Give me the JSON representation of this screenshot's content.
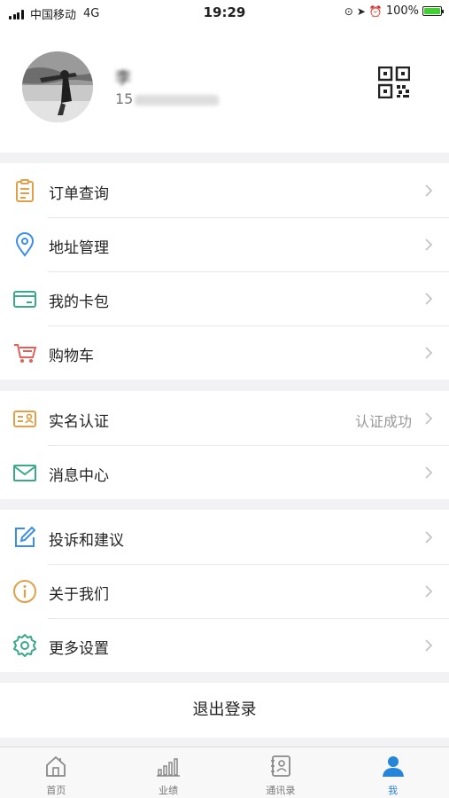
{
  "status_bar": {
    "carrier": "中国移动",
    "network": "4G",
    "time": "19:29",
    "battery_text": "100%",
    "battery_level": 1.0
  },
  "profile": {
    "name": "李",
    "phone_prefix": "15"
  },
  "menu_group_1": [
    {
      "label": "订单查询",
      "icon": "clipboard-icon"
    },
    {
      "label": "地址管理",
      "icon": "location-pin-icon"
    },
    {
      "label": "我的卡包",
      "icon": "card-icon"
    },
    {
      "label": "购物车",
      "icon": "cart-icon"
    }
  ],
  "menu_group_2": [
    {
      "label": "实名认证",
      "value": "认证成功",
      "icon": "id-card-icon"
    },
    {
      "label": "消息中心",
      "icon": "envelope-icon"
    }
  ],
  "menu_group_3": [
    {
      "label": "投诉和建议",
      "icon": "edit-icon"
    },
    {
      "label": "关于我们",
      "icon": "info-icon"
    },
    {
      "label": "更多设置",
      "icon": "gear-icon"
    }
  ],
  "logout": {
    "label": "退出登录"
  },
  "tabbar": [
    {
      "label": "首页",
      "icon": "home-icon"
    },
    {
      "label": "业绩",
      "icon": "bar-chart-icon"
    },
    {
      "label": "通讯录",
      "icon": "contacts-icon"
    },
    {
      "label": "我",
      "icon": "person-icon",
      "active": true
    }
  ],
  "colors": {
    "accent": "#2585d8",
    "orange": "#e0a04a",
    "blue": "#3a8ee6",
    "teal": "#39a98a",
    "red": "#e0605a"
  }
}
